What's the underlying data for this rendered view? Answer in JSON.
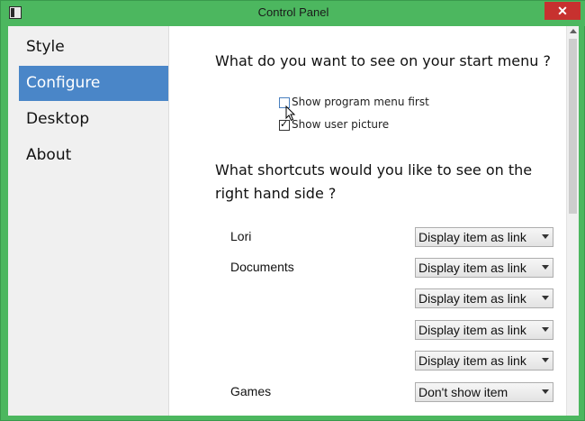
{
  "window": {
    "title": "Control Panel",
    "close_glyph": "✕"
  },
  "sidebar": {
    "items": [
      {
        "label": "Style",
        "active": false
      },
      {
        "label": "Configure",
        "active": true
      },
      {
        "label": "Desktop",
        "active": false
      },
      {
        "label": "About",
        "active": false
      }
    ]
  },
  "main": {
    "start_menu_question": "What do you want to see on your start menu ?",
    "checkboxes": [
      {
        "label": "Show program menu first",
        "checked": false
      },
      {
        "label": "Show user picture",
        "checked": true
      }
    ],
    "shortcuts_question_line1": "What shortcuts would you like to see on the",
    "shortcuts_question_line2": "right hand side ?",
    "shortcuts": [
      {
        "label": "Lori",
        "value": "Display item as link"
      },
      {
        "label": "Documents",
        "value": "Display item as link"
      },
      {
        "label": "",
        "value": "Display item as link"
      },
      {
        "label": "",
        "value": "Display item as link"
      },
      {
        "label": "",
        "value": "Display item as link"
      },
      {
        "label": "Games",
        "value": "Don't show item"
      }
    ]
  },
  "colors": {
    "frame": "#4cb75f",
    "accent": "#4a86c8",
    "close": "#c7312f"
  },
  "icons": {
    "app": "window-app-icon",
    "close": "close-icon",
    "cursor": "mouse-cursor-icon"
  }
}
